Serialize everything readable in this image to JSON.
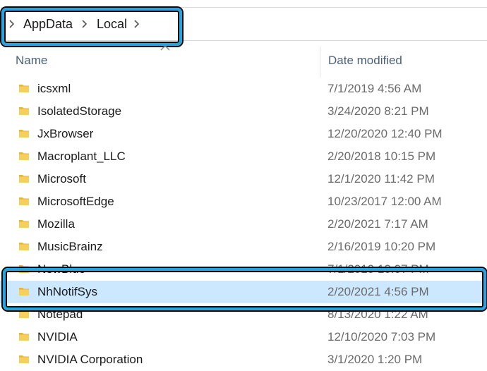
{
  "address_bar": {
    "crumbs": [
      "AppData",
      "Local"
    ]
  },
  "columns": {
    "name": "Name",
    "date_modified": "Date modified"
  },
  "highlight_color": "#29a3e0",
  "selection_color": "#cce8ff",
  "folder_color": "#f3c54d",
  "files": [
    {
      "name": "icsxml",
      "date": "7/1/2019 4:56 AM"
    },
    {
      "name": "IsolatedStorage",
      "date": "3/24/2020 8:21 PM"
    },
    {
      "name": "JxBrowser",
      "date": "12/20/2020 12:40 PM"
    },
    {
      "name": "Macroplant_LLC",
      "date": "2/20/2018 10:15 PM"
    },
    {
      "name": "Microsoft",
      "date": "12/1/2020 11:42 PM"
    },
    {
      "name": "MicrosoftEdge",
      "date": "10/23/2017 12:00 AM"
    },
    {
      "name": "Mozilla",
      "date": "2/20/2021 7:17 AM"
    },
    {
      "name": "MusicBrainz",
      "date": "2/16/2019 10:20 PM"
    },
    {
      "name": "NewBlue",
      "date": "7/1/2019 10:07 PM"
    },
    {
      "name": "NhNotifSys",
      "date": "2/20/2021 4:56 PM",
      "selected": true
    },
    {
      "name": "Notepad",
      "date": "8/13/2020 1:22 AM"
    },
    {
      "name": "NVIDIA",
      "date": "12/10/2020 7:03 PM"
    },
    {
      "name": "NVIDIA Corporation",
      "date": "3/1/2020 1:20 PM"
    }
  ]
}
